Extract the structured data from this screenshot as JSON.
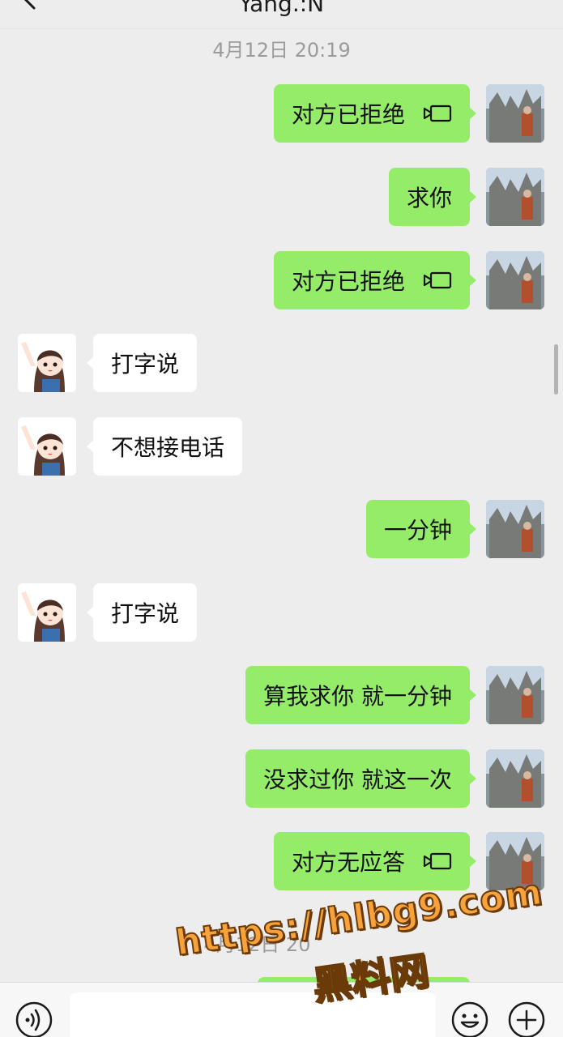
{
  "header": {
    "title": "Yang.:N",
    "back_icon": "chevron-left-icon"
  },
  "timestamps": {
    "first": "4月12日 20:19",
    "second": "4月12日 20"
  },
  "messages": [
    {
      "dir": "out",
      "text": "对方已拒绝",
      "call_icon": true
    },
    {
      "dir": "out",
      "text": "求你",
      "call_icon": false
    },
    {
      "dir": "out",
      "text": "对方已拒绝",
      "call_icon": true
    },
    {
      "dir": "in",
      "text": "打字说",
      "call_icon": false
    },
    {
      "dir": "in",
      "text": "不想接电话",
      "call_icon": false
    },
    {
      "dir": "out",
      "text": "一分钟",
      "call_icon": false
    },
    {
      "dir": "in",
      "text": "打字说",
      "call_icon": false
    },
    {
      "dir": "out",
      "text": "算我求你 就一分钟",
      "call_icon": false
    },
    {
      "dir": "out",
      "text": "没求过你 就这一次",
      "call_icon": false
    },
    {
      "dir": "out",
      "text": "对方无应答",
      "call_icon": true
    }
  ],
  "input_bar": {
    "voice_icon": "voice-icon",
    "emoji_icon": "emoji-icon",
    "plus_icon": "plus-icon",
    "placeholder": ""
  },
  "watermark": {
    "url": "https://hlbg9.com",
    "name": "黑料网"
  },
  "colors": {
    "background": "#ededed",
    "outgoing_bubble": "#95ec69",
    "incoming_bubble": "#ffffff",
    "watermark": "#f7a23a"
  }
}
